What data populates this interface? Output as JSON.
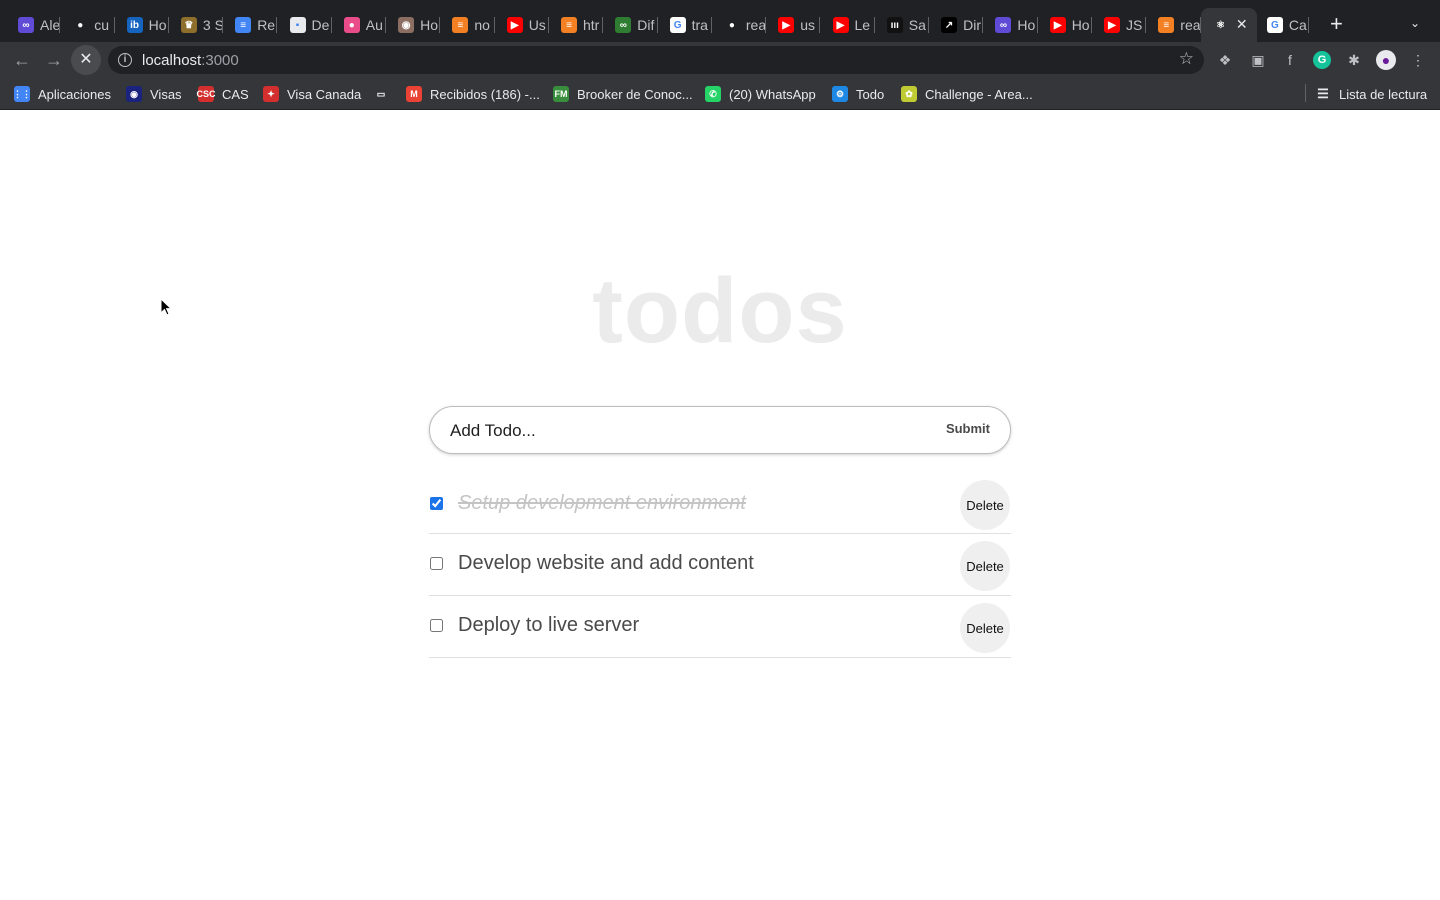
{
  "browser": {
    "tabs": [
      {
        "label": "Ale",
        "color": "#5f4bd6",
        "glyph": "∞"
      },
      {
        "label": "cu",
        "color": "#202124",
        "glyph": "●"
      },
      {
        "label": "Ho",
        "color": "#1565c0",
        "glyph": "ib"
      },
      {
        "label": "3 S",
        "color": "#8d6e2b",
        "glyph": "♛"
      },
      {
        "label": "Re",
        "color": "#4285f4",
        "glyph": "≡"
      },
      {
        "label": "De",
        "color": "#e8eaed",
        "glyph": "▪"
      },
      {
        "label": "Au",
        "color": "#ea4c89",
        "glyph": "●"
      },
      {
        "label": "Ho",
        "color": "#8d6e63",
        "glyph": "◉"
      },
      {
        "label": "no",
        "color": "#f48024",
        "glyph": "≡"
      },
      {
        "label": "Us",
        "color": "#ff0000",
        "glyph": "▶"
      },
      {
        "label": "htr",
        "color": "#f48024",
        "glyph": "≡"
      },
      {
        "label": "Dif",
        "color": "#2e7d32",
        "glyph": "∞"
      },
      {
        "label": "tra",
        "color": "#ffffff",
        "glyph": "G"
      },
      {
        "label": "rea",
        "color": "#202124",
        "glyph": "●"
      },
      {
        "label": "us",
        "color": "#ff0000",
        "glyph": "▶"
      },
      {
        "label": "Le",
        "color": "#ff0000",
        "glyph": "▶"
      },
      {
        "label": "Sa",
        "color": "#111111",
        "glyph": "ııı"
      },
      {
        "label": "Dir",
        "color": "#000000",
        "glyph": "↗"
      },
      {
        "label": "Ho",
        "color": "#5f4bd6",
        "glyph": "∞"
      },
      {
        "label": "Ho",
        "color": "#ff0000",
        "glyph": "▶"
      },
      {
        "label": "JS",
        "color": "#ff0000",
        "glyph": "▶"
      },
      {
        "label": "rea",
        "color": "#f48024",
        "glyph": "≡"
      },
      {
        "label": "",
        "color": "#35363a",
        "glyph": "⚛"
      },
      {
        "label": "Ca",
        "color": "#ffffff",
        "glyph": "G"
      }
    ],
    "active_tab_index": 22,
    "url_host": "localhost",
    "url_port": ":3000",
    "bookmarks": [
      {
        "label": "Aplicaciones",
        "color": "#4285f4",
        "glyph": "⋮⋮"
      },
      {
        "label": "Visas",
        "color": "#1a237e",
        "glyph": "◉"
      },
      {
        "label": "CAS",
        "color": "#d32f2f",
        "glyph": "CSC"
      },
      {
        "label": "Visa Canada",
        "color": "#d32f2f",
        "glyph": "✦"
      },
      {
        "label": "",
        "color": "#35363a",
        "glyph": "▭"
      },
      {
        "label": "Recibidos (186) -...",
        "color": "#ea4335",
        "glyph": "M"
      },
      {
        "label": "Brooker de Conoc...",
        "color": "#388e3c",
        "glyph": "FM"
      },
      {
        "label": "(20) WhatsApp",
        "color": "#25d366",
        "glyph": "✆"
      },
      {
        "label": "Todo",
        "color": "#1e88e5",
        "glyph": "⚙"
      },
      {
        "label": "Challenge - Area...",
        "color": "#c0ca33",
        "glyph": "✿"
      }
    ],
    "reading_list_label": "Lista de lectura"
  },
  "app": {
    "title": "todos",
    "input_placeholder": "Add Todo...",
    "submit_label": "Submit",
    "todos": [
      {
        "text": "Setup development environment",
        "completed": true,
        "delete_label": "Delete"
      },
      {
        "text": "Develop website and add content",
        "completed": false,
        "delete_label": "Delete"
      },
      {
        "text": "Deploy to live server",
        "completed": false,
        "delete_label": "Delete"
      }
    ]
  }
}
